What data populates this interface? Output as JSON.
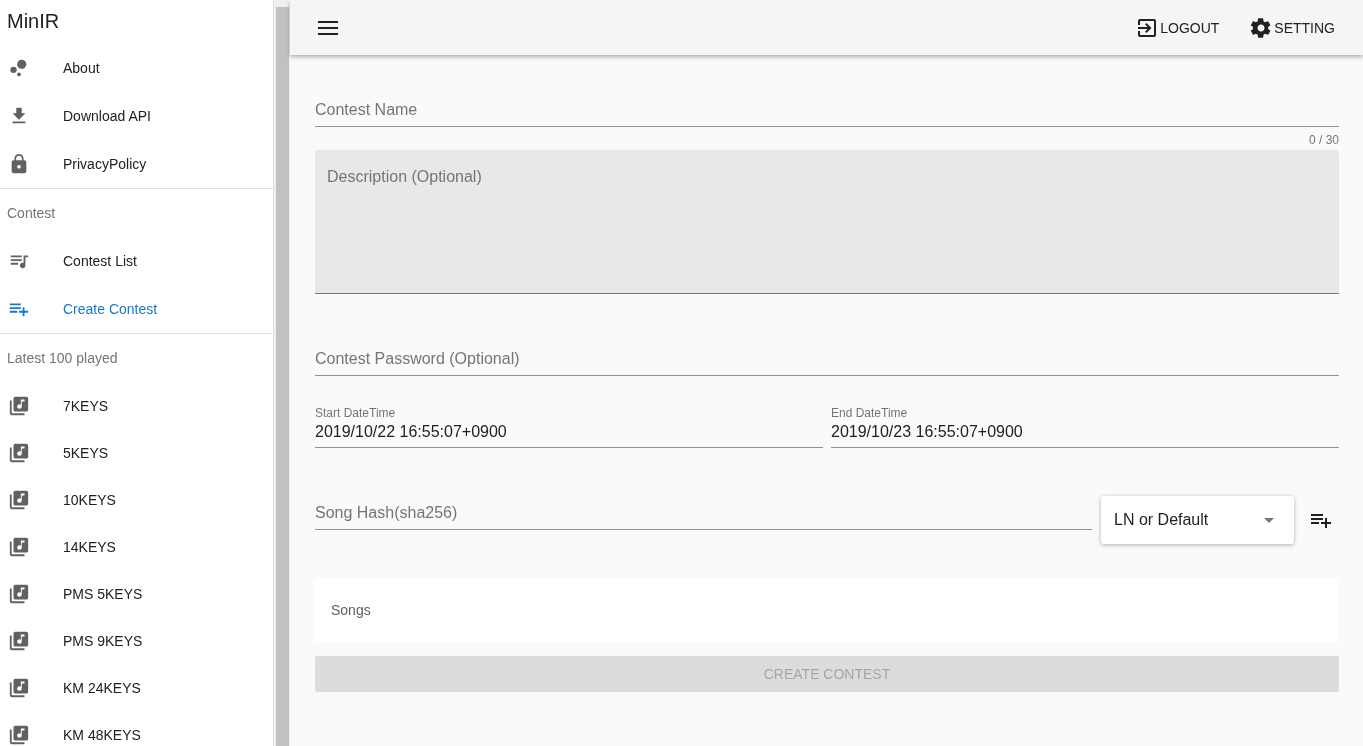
{
  "app_title": "MinIR",
  "sidebar": [
    {
      "items": [
        {
          "kind": "bubbles",
          "label": "About",
          "selected": false
        },
        {
          "kind": "download",
          "label": "Download API",
          "selected": false
        },
        {
          "kind": "lock",
          "label": "PrivacyPolicy",
          "selected": false
        }
      ]
    },
    {
      "header": "Contest",
      "items": [
        {
          "kind": "queue-music",
          "label": "Contest List",
          "selected": false
        },
        {
          "kind": "playlist-add",
          "label": "Create Contest",
          "selected": true
        }
      ]
    },
    {
      "header": "Latest 100 played",
      "items": [
        {
          "kind": "library-music",
          "label": "7KEYS",
          "selected": false
        },
        {
          "kind": "library-music",
          "label": "5KEYS",
          "selected": false
        },
        {
          "kind": "library-music",
          "label": "10KEYS",
          "selected": false
        },
        {
          "kind": "library-music",
          "label": "14KEYS",
          "selected": false
        },
        {
          "kind": "library-music",
          "label": "PMS 5KEYS",
          "selected": false
        },
        {
          "kind": "library-music",
          "label": "PMS 9KEYS",
          "selected": false
        },
        {
          "kind": "library-music",
          "label": "KM 24KEYS",
          "selected": false
        },
        {
          "kind": "library-music",
          "label": "KM 48KEYS",
          "selected": false
        }
      ]
    }
  ],
  "toolbar": {
    "actions": [
      {
        "kind": "logout",
        "label": "LOGOUT"
      },
      {
        "kind": "gear",
        "label": "SETTING"
      }
    ]
  },
  "form": {
    "contest_name": {
      "placeholder": "Contest Name",
      "counter": "0 / 30"
    },
    "description": {
      "placeholder": "Description (Optional)"
    },
    "password": {
      "placeholder": "Contest Password (Optional)"
    },
    "start": {
      "label": "Start DateTime",
      "value": "2019/10/22 16:55:07+0900"
    },
    "end": {
      "label": "End DateTime",
      "value": "2019/10/23 16:55:07+0900"
    },
    "song_hash": {
      "placeholder": "Song Hash(sha256)"
    },
    "mode_select": {
      "value": "LN or Default"
    },
    "songs_label": "Songs",
    "create_button": {
      "label": "CREATE CONTEST",
      "disabled": true
    }
  }
}
